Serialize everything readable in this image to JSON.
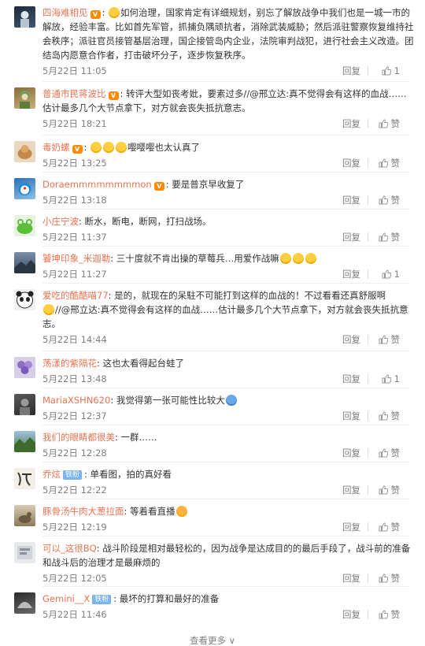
{
  "comments": [
    {
      "user": "四海难相见",
      "badge": "",
      "text": "如何治理，国家肯定有详细规划，别忘了解放战争中我们也是一城一市的解放，经验丰富。比如首先军管，抓捕负隅顽抗者，消除武装威胁；然后派驻警察恢复维持社会秩序；派驻官员接管基层治理，国企接管岛内企业，法院审判战犯，进行社会主义改造。团结岛内愿意合作者，打击破坏分子，逐步恢复秩序。",
      "time": "5月22日 11:05",
      "reply": "回复",
      "like": "1"
    },
    {
      "user": "普通市民蒋波比",
      "badge": "",
      "text": "转评大型如丧考妣，要素过多//@邢立达:真不觉得会有这样的血战……估计最多几个大节点拿下，对方就会丧失抵抗意志。",
      "time": "5月22日 18:21",
      "reply": "回复",
      "like": "赞"
    },
    {
      "user": "毒奶螺",
      "badge": "",
      "text": "嘤嘤嘤也太认真了",
      "time": "5月22日 13:25",
      "reply": "回复",
      "like": "赞"
    },
    {
      "user": "Doraemmmmmmmmon",
      "badge": "",
      "text": "要是普京早收复了",
      "time": "5月22日 13:18",
      "reply": "回复",
      "like": "赞"
    },
    {
      "user": "小庄宁波",
      "badge": "",
      "text": "断水，断电，断网，打扫战场。",
      "time": "5月22日 11:37",
      "reply": "回复",
      "like": "赞"
    },
    {
      "user": "饕坤印象_米迦勒",
      "badge": "",
      "text": "三十度就不肯出操的草莓兵…用爱作战嘛",
      "time": "5月22日 11:27",
      "reply": "回复",
      "like": "1"
    },
    {
      "user": "爱吃的酷酷喵77",
      "badge": "",
      "text": "是的，就现在的呆駐不可能打到这样的血战的！不过看看还真舒服啊",
      "text2": "//@邢立达:真不觉得会有这样的血战……估计最多几个大节点拿下，对方就会丧失抵抗意志。",
      "time": "5月22日 14:44",
      "reply": "回复",
      "like": "赞"
    },
    {
      "user": "荡漾的紫隔花",
      "badge": "",
      "text": "这也太看得起台蛙了",
      "time": "5月22日 13:48",
      "reply": "回复",
      "like": "1"
    },
    {
      "user": "MariaXSHN620",
      "badge": "",
      "text": "我觉得第一张可能性比较大",
      "time": "5月22日 12:37",
      "reply": "回复",
      "like": "赞"
    },
    {
      "user": "我们的眼睛都很美",
      "badge": "",
      "text": "一群……",
      "time": "5月22日 12:28",
      "reply": "回复",
      "like": "赞"
    },
    {
      "user": "乔炫",
      "badge": "铁粉",
      "text": "单看图，拍的真好看",
      "time": "5月22日 12:22",
      "reply": "回复",
      "like": "赞"
    },
    {
      "user": "豚骨汤牛肉大葱拉面",
      "badge": "",
      "text": "等着看直播",
      "time": "5月22日 12:19",
      "reply": "回复",
      "like": "赞"
    },
    {
      "user": "可以_这很BQ",
      "badge": "",
      "text": "战斗阶段是相对最轻松的，因为战争是达成目的的最后手段了，战斗前的准备和战斗后的治理才是最麻烦的",
      "time": "5月22日 12:05",
      "reply": "回复",
      "like": "赞"
    },
    {
      "user": "Gemini__X",
      "badge": "铁粉",
      "text": "最坏的打算和最好的准备",
      "time": "5月22日 11:46",
      "reply": "回复",
      "like": "赞"
    }
  ],
  "load_more": "查看更多 ∨",
  "colors": {
    "accent": "#eb7350",
    "meta": "#808080",
    "fan_badge": "#7ab4f0"
  }
}
